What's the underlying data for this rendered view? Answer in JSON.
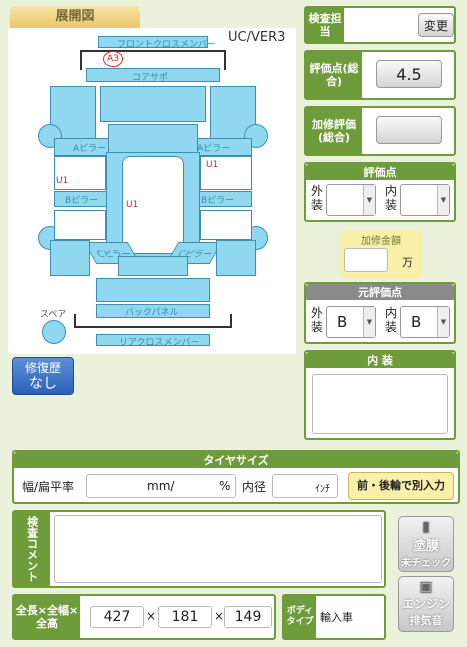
{
  "diagram": {
    "tab": "展開図",
    "version": "UC/VER3",
    "parts": {
      "front_cross_member": "フロントクロスメンバー",
      "core_support": "コアサポ",
      "a_pillar_left": "Aピラー",
      "a_pillar_right": "Aピラー",
      "b_pillar_left": "Bピラー",
      "b_pillar_right": "Bピラー",
      "c_pillar_left": "Cピラー",
      "c_pillar_right": "Cピラー",
      "back_panel": "バックパネル",
      "rear_cross_member": "リアクロスメンバー",
      "spare": "スペア"
    },
    "marker": "A3",
    "damage_marks": [
      "U1",
      "U1",
      "U1"
    ]
  },
  "repair_history": {
    "title": "修復歴",
    "value": "なし"
  },
  "inspector": {
    "label": "検査担当",
    "change_button": "変更"
  },
  "score_total": {
    "label": "評価点(総合)",
    "value": "4.5"
  },
  "repair_score": {
    "label": "加修評価(総合)",
    "value": ""
  },
  "score_detail": {
    "title": "評価点",
    "exterior": "外装",
    "interior": "内装"
  },
  "repair_cost": {
    "title": "加修金額",
    "unit": "万",
    "value": ""
  },
  "original_score": {
    "title": "元評価点",
    "exterior_label": "外装",
    "exterior": "B",
    "interior_label": "内装",
    "interior": "B"
  },
  "interior": {
    "title": "内 装"
  },
  "tire": {
    "title": "タイヤサイズ",
    "width_label": "幅/扁平率",
    "mm": "mm/",
    "pct": "%",
    "inner_label": "内径",
    "inch": "ｲﾝﾁ",
    "split_button": "前・後輪で別入力"
  },
  "comment": {
    "label": "検査コメント",
    "value": ""
  },
  "dimensions": {
    "label": "全長×全幅×全高",
    "length": "427",
    "width": "181",
    "height": "149",
    "x": "×"
  },
  "body_type": {
    "label": "ボディタイプ",
    "value": "輸入車"
  },
  "paint_button": {
    "title": "塗膜",
    "sub": "未チェック"
  },
  "engine_button": {
    "title": "エンジン",
    "sub": "排気音"
  }
}
